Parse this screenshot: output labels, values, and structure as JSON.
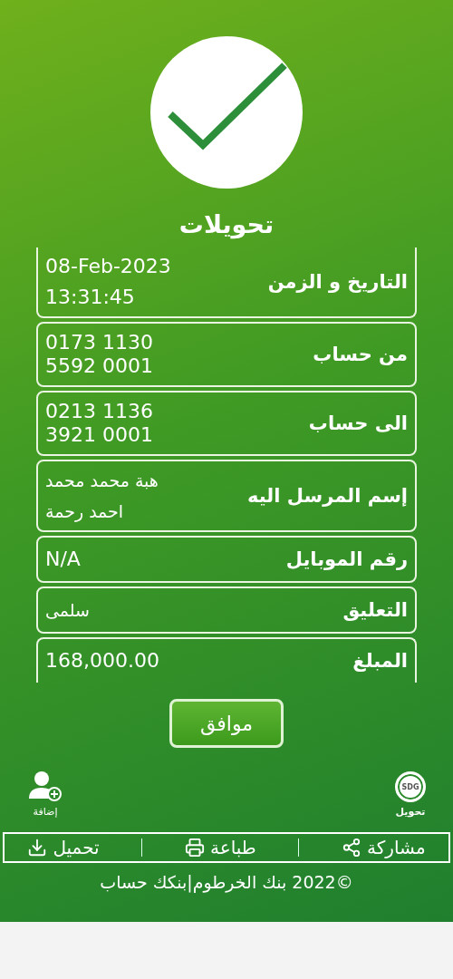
{
  "title": "تحويلات",
  "details": [
    {
      "label": "التاريخ و الزمن",
      "lines": [
        "08-Feb-2023",
        "13:31:45"
      ],
      "kind": "spaced"
    },
    {
      "label": "من حساب",
      "lines": [
        "0173 1130",
        "5592 0001"
      ],
      "kind": "tight"
    },
    {
      "label": "الى حساب",
      "lines": [
        "0213 1136",
        "3921 0001"
      ],
      "kind": "tight"
    },
    {
      "label": "إسم المرسل اليه",
      "lines": [
        "هبة محمد محمد",
        "احمد رحمة"
      ],
      "kind": "spaced"
    },
    {
      "label": "رقم الموبايل",
      "lines": [
        "N/A"
      ],
      "kind": "tight"
    },
    {
      "label": "التعليق",
      "lines": [
        "سلمى"
      ],
      "kind": "tight"
    },
    {
      "label": "المبلغ",
      "lines": [
        "168,000.00"
      ],
      "kind": "tight"
    }
  ],
  "ok_button": "موافق",
  "shortcuts": [
    {
      "kind": "transfer",
      "label": "تحويل",
      "badge": "SDG"
    },
    {
      "kind": "add-contact",
      "label": "إضافة"
    }
  ],
  "actions": [
    {
      "kind": "share",
      "label": "مشاركة"
    },
    {
      "kind": "print",
      "label": "طباعة"
    },
    {
      "kind": "download",
      "label": "تحميل"
    }
  ],
  "copyright": "©2022 بنك الخرطوم|بنكك حساب"
}
